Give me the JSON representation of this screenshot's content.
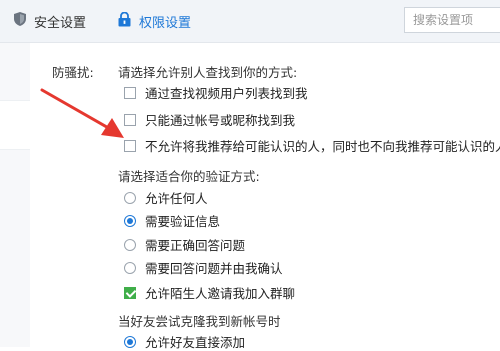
{
  "topbar": {
    "security_tab": "安全设置",
    "permission_tab": "权限设置",
    "search_placeholder": "搜索设置项"
  },
  "anti_harassment": {
    "label": "防骚扰:",
    "find_me_heading": "请选择允许别人查找到你的方式:",
    "find_me_options": [
      {
        "label": "通过查找视频用户列表找到我",
        "checked": false
      },
      {
        "label": "只能通过帐号或昵称找到我",
        "checked": false
      },
      {
        "label": "不允许将我推荐给可能认识的人，同时也不向我推荐可能认识的人",
        "checked": false
      }
    ],
    "verify_heading": "请选择适合你的验证方式:",
    "verify_options": [
      {
        "label": "允许任何人",
        "selected": false
      },
      {
        "label": "需要验证信息",
        "selected": true
      },
      {
        "label": "需要正确回答问题",
        "selected": false
      },
      {
        "label": "需要回答问题并由我确认",
        "selected": false
      }
    ],
    "group_invite": {
      "label": "允许陌生人邀请我加入群聊",
      "checked": true
    },
    "new_account_heading": "当好友尝试克隆我到新帐号时",
    "new_account_options": [
      {
        "label": "允许好友直接添加",
        "selected": true
      }
    ]
  },
  "colors": {
    "accent_blue": "#1e78d7",
    "check_green": "#3fae49",
    "arrow_red": "#e5382f"
  }
}
